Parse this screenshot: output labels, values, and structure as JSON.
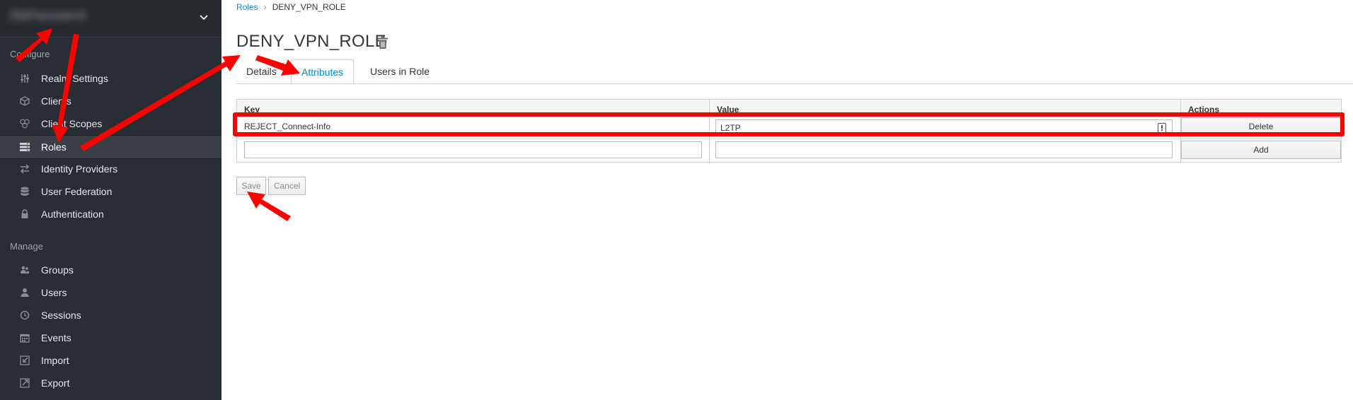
{
  "sidebar": {
    "realm_name": "DbPasswerd",
    "configure_label": "Configure",
    "manage_label": "Manage",
    "configure_items": [
      {
        "label": "Realm Settings",
        "icon": "sliders-icon"
      },
      {
        "label": "Clients",
        "icon": "cube-icon"
      },
      {
        "label": "Client Scopes",
        "icon": "cubes-icon"
      },
      {
        "label": "Roles",
        "icon": "list-icon",
        "active": true
      },
      {
        "label": "Identity Providers",
        "icon": "exchange-icon"
      },
      {
        "label": "User Federation",
        "icon": "database-icon"
      },
      {
        "label": "Authentication",
        "icon": "lock-icon"
      }
    ],
    "manage_items": [
      {
        "label": "Groups",
        "icon": "users-icon"
      },
      {
        "label": "Users",
        "icon": "user-icon"
      },
      {
        "label": "Sessions",
        "icon": "clock-icon"
      },
      {
        "label": "Events",
        "icon": "calendar-icon"
      },
      {
        "label": "Import",
        "icon": "import-icon"
      },
      {
        "label": "Export",
        "icon": "export-icon"
      }
    ]
  },
  "breadcrumb": {
    "parent": "Roles",
    "separator": "›",
    "current": "DENY_VPN_ROLE"
  },
  "page": {
    "title": "DENY_VPN_ROLE"
  },
  "tabs": [
    {
      "label": "Details"
    },
    {
      "label": "Attributes",
      "active": true
    },
    {
      "label": "Users in Role"
    }
  ],
  "table": {
    "headers": {
      "key": "Key",
      "value": "Value",
      "actions": "Actions"
    },
    "rows": [
      {
        "key": "REJECT_Connect-Info",
        "value": "L2TP",
        "action": "Delete"
      }
    ],
    "new_row": {
      "key": "",
      "value": "",
      "action": "Add"
    }
  },
  "buttons": {
    "save": "Save",
    "cancel": "Cancel"
  },
  "colors": {
    "sidebar_bg": "#292e34",
    "link": "#0088ce",
    "annotation": "#ff0000"
  }
}
